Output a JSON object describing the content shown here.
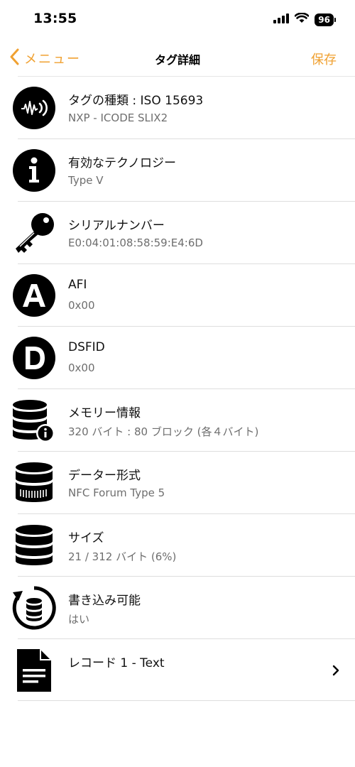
{
  "status": {
    "time": "13:55",
    "battery": "96"
  },
  "nav": {
    "back_label": "メニュー",
    "title": "タグ詳細",
    "save_label": "保存"
  },
  "rows": [
    {
      "icon": "nfc-waveform-icon",
      "title": "タグの種類 : ISO 15693",
      "sub": "NXP - ICODE SLIX2"
    },
    {
      "icon": "info-icon",
      "title": "有効なテクノロジー",
      "sub": "Type V"
    },
    {
      "icon": "key-icon",
      "title": "シリアルナンバー",
      "sub": "E0:04:01:08:58:59:E4:6D"
    },
    {
      "icon": "letter-a-icon",
      "title": "AFI",
      "sub": "0x00"
    },
    {
      "icon": "letter-d-icon",
      "title": "DSFID",
      "sub": "0x00"
    },
    {
      "icon": "database-info-icon",
      "title": "メモリー情報",
      "sub": "320 バイト : 80 ブロック (各４バイト)"
    },
    {
      "icon": "database-format-icon",
      "title": "データー形式",
      "sub": "NFC Forum Type 5"
    },
    {
      "icon": "database-icon",
      "title": "サイズ",
      "sub": "21 / 312 バイト (6%)"
    },
    {
      "icon": "database-refresh-icon",
      "title": "書き込み可能",
      "sub": "はい"
    }
  ],
  "record": {
    "icon": "document-icon",
    "title": "レコード 1 - Text"
  },
  "colors": {
    "accent": "#f0a131",
    "separator": "#dedede",
    "subtitle": "#6e6e6e"
  }
}
